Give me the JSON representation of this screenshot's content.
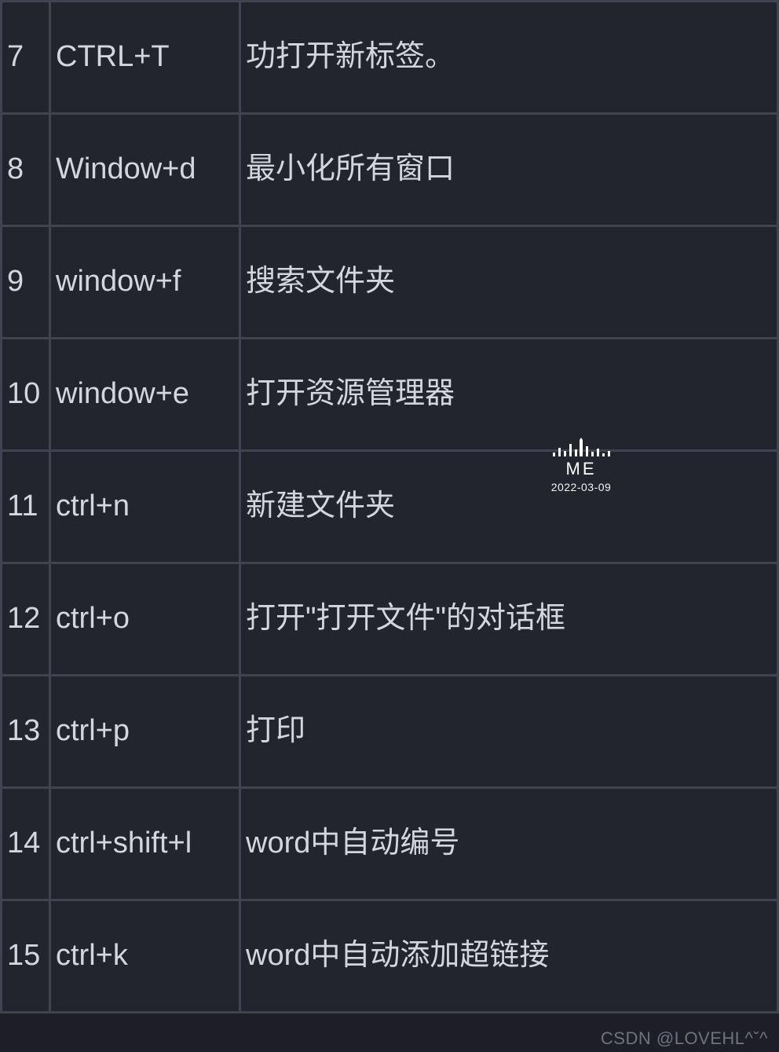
{
  "table": {
    "rows": [
      {
        "num": "7",
        "key": "CTRL+T",
        "desc": "功打开新标签。"
      },
      {
        "num": "8",
        "key": "Window+d",
        "desc": "最小化所有窗口"
      },
      {
        "num": "9",
        "key": "window+f",
        "desc": "搜索文件夹"
      },
      {
        "num": "10",
        "key": "window+e",
        "desc": "打开资源管理器"
      },
      {
        "num": "11",
        "key": "ctrl+n",
        "desc": "新建文件夹"
      },
      {
        "num": "12",
        "key": "ctrl+o",
        "desc": "打开\"打开文件\"的对话框"
      },
      {
        "num": "13",
        "key": "ctrl+p",
        "desc": "打印"
      },
      {
        "num": "14",
        "key": "ctrl+shift+l",
        "desc": "word中自动编号"
      },
      {
        "num": "15",
        "key": "ctrl+k",
        "desc": "word中自动添加超链接"
      }
    ]
  },
  "watermark": {
    "label": "ME",
    "date": "2022-03-09"
  },
  "footer": {
    "credit": "CSDN @LOVEHL^ˇ^"
  }
}
